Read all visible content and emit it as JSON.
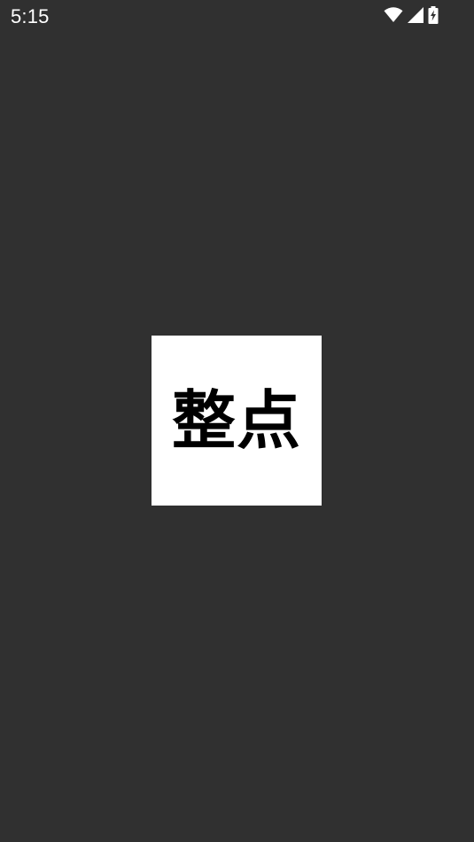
{
  "status_bar": {
    "time": "5:15",
    "icons": [
      "wifi-icon",
      "cellular-signal-icon",
      "battery-charging-icon"
    ],
    "icon_color": "#ffffff"
  },
  "splash": {
    "logo_text": "整点",
    "background_color": "#303030",
    "logo_background": "#ffffff",
    "logo_text_color": "#000000"
  }
}
